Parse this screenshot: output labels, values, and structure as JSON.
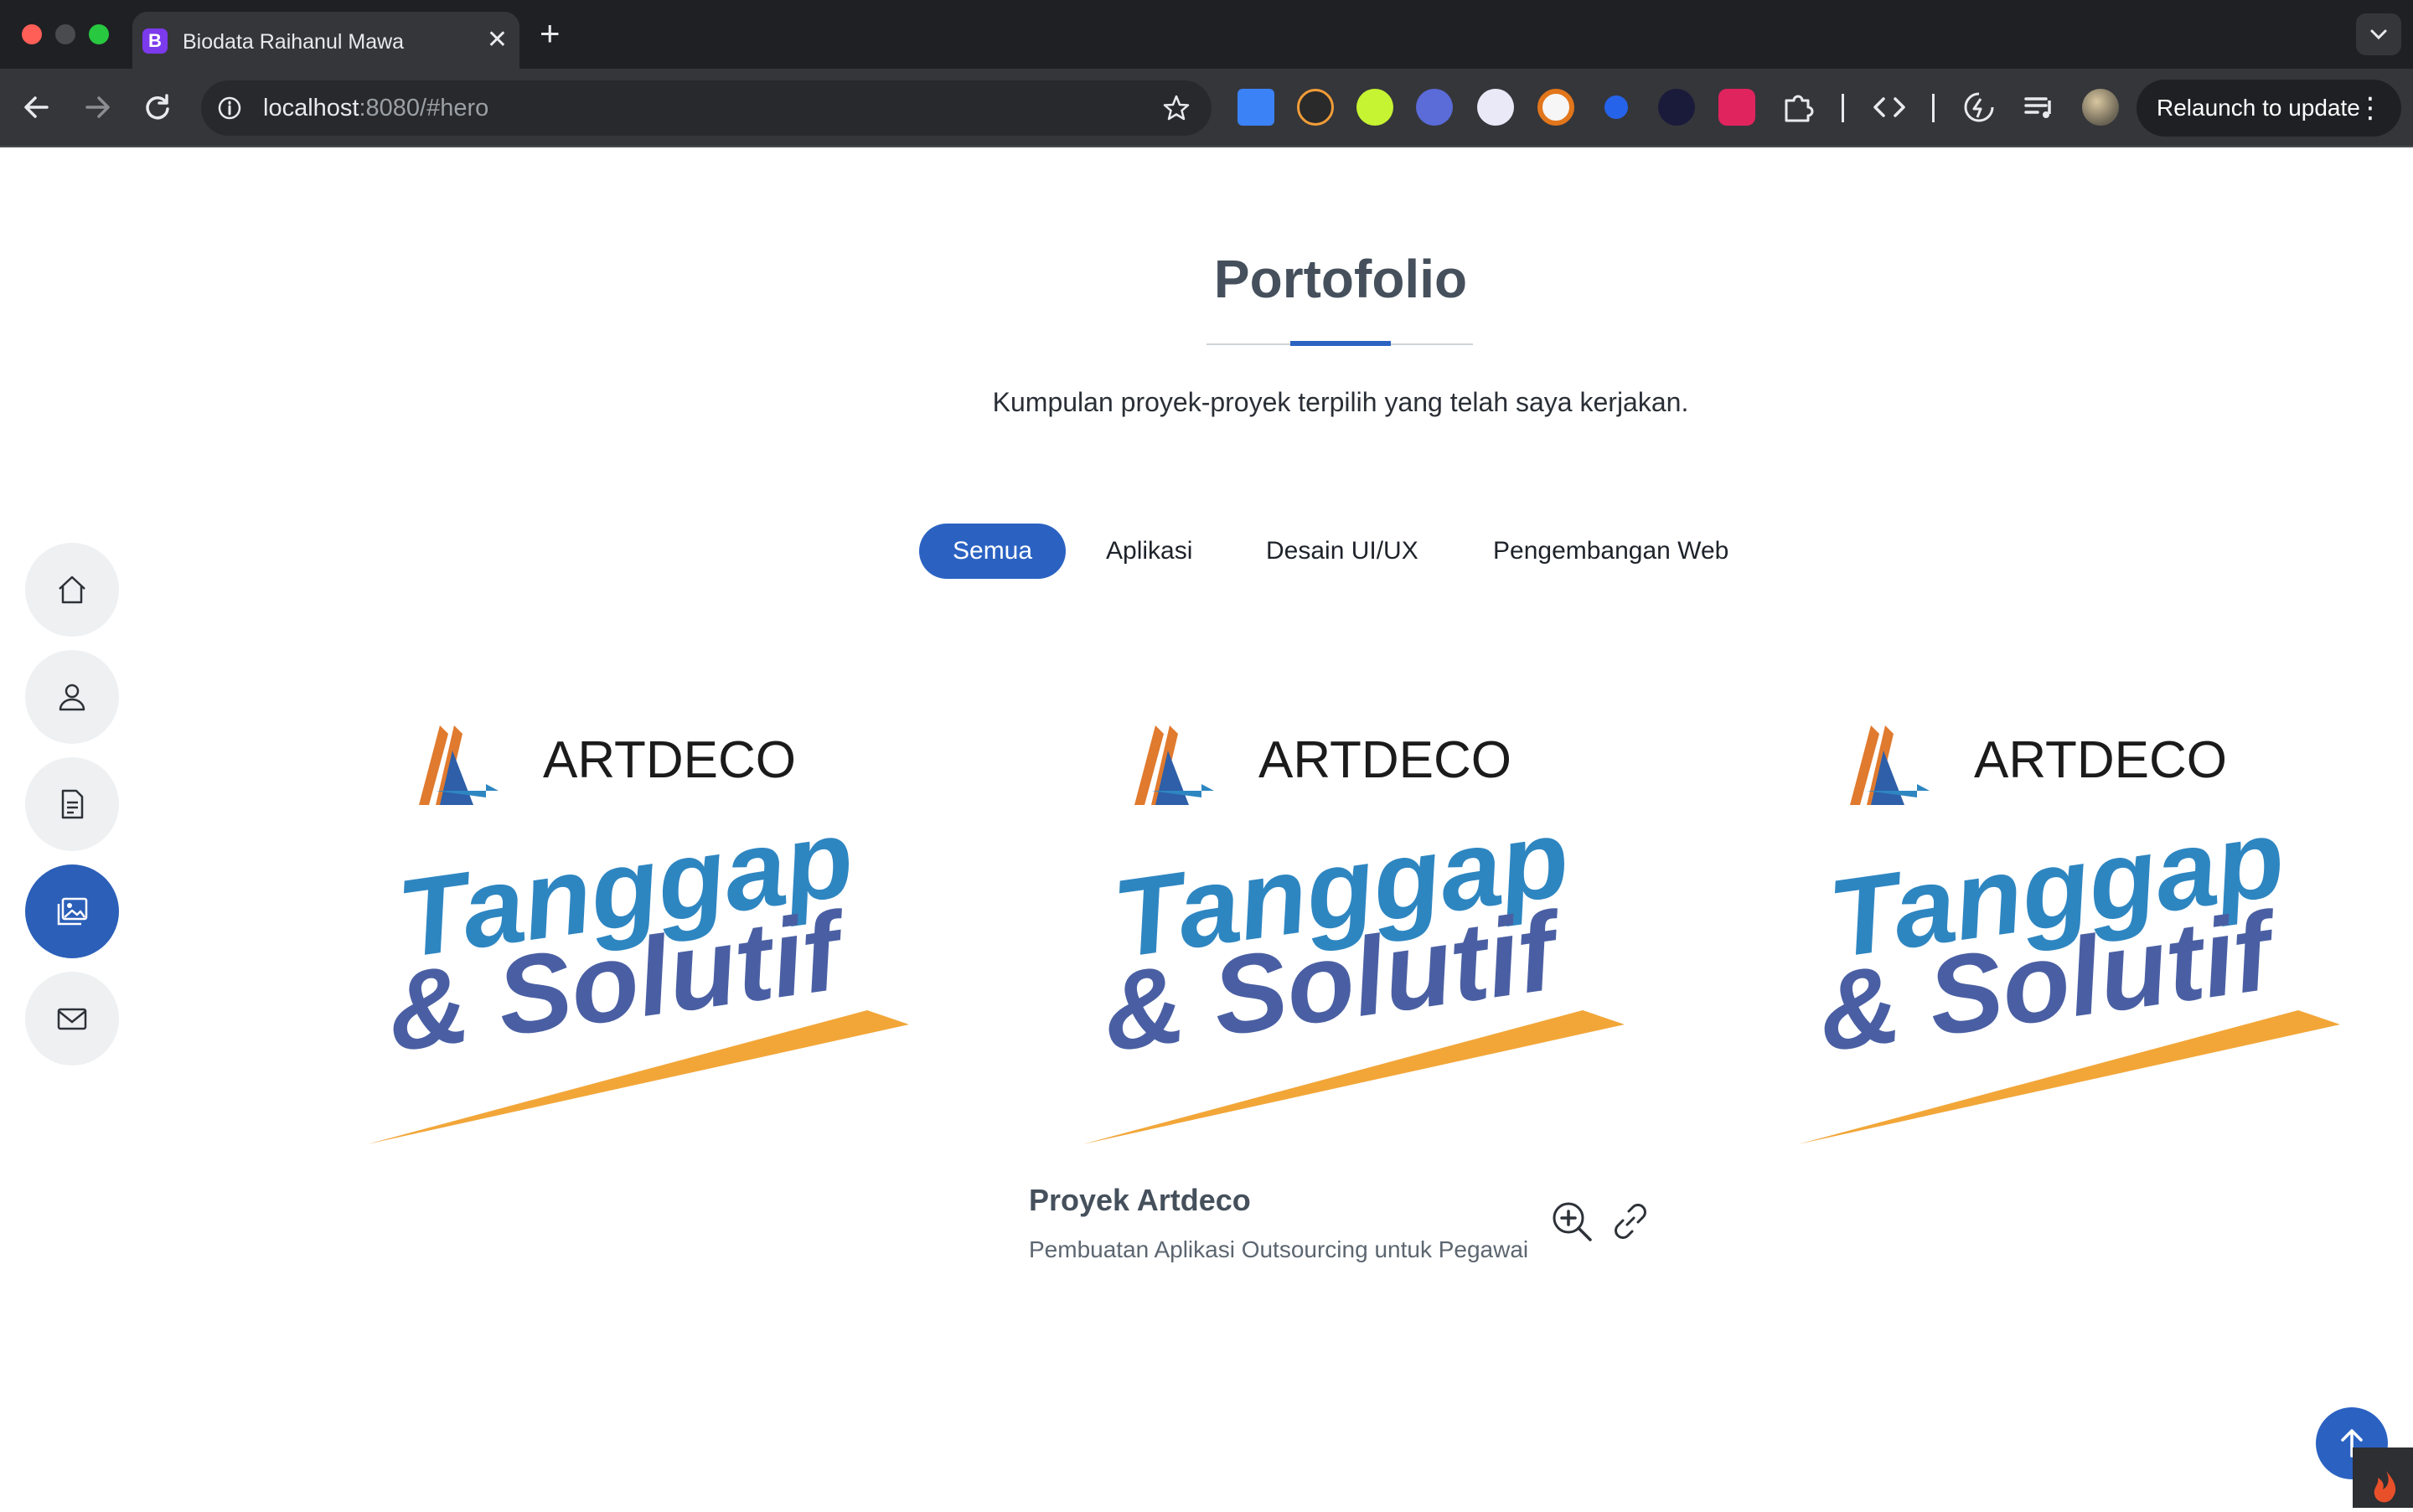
{
  "browser": {
    "tab_title": "Biodata Raihanul Mawa",
    "tab_favicon_letter": "B",
    "url_host": "localhost",
    "url_rest": ":8080/#hero",
    "relaunch_label": "Relaunch to update",
    "extensions": [
      "extension-1-icon",
      "extension-2-icon",
      "extension-3-icon",
      "extension-4-icon",
      "extension-5-icon",
      "metamask-icon",
      "extension-7-icon",
      "extension-8-icon",
      "shield-u-icon",
      "puzzle-icon",
      "code-icon",
      "extension-12-icon",
      "media-queue-icon",
      "profile-avatar-icon"
    ]
  },
  "page": {
    "section_title": "Portofolio",
    "subtitle": "Kumpulan proyek-proyek terpilih yang telah saya kerjakan.",
    "filters": [
      "Semua",
      "Aplikasi",
      "Desain UI/UX",
      "Pengembangan Web"
    ],
    "active_filter": "Semua",
    "sidenav": [
      "home-icon",
      "person-icon",
      "document-icon",
      "gallery-icon",
      "envelope-icon"
    ],
    "sidenav_active": "gallery-icon",
    "cards": [
      {
        "brand": "ARTDECO",
        "slogan_line1": "Tanggap",
        "slogan_line2": "& Solutif"
      },
      {
        "brand": "ARTDECO",
        "slogan_line1": "Tanggap",
        "slogan_line2": "& Solutif"
      },
      {
        "brand": "ARTDECO",
        "slogan_line1": "Tanggap",
        "slogan_line2": "& Solutif"
      }
    ],
    "featured": {
      "title": "Proyek Artdeco",
      "description": "Pembuatan Aplikasi Outsourcing untuk Pegawai"
    }
  },
  "colors": {
    "accent": "#2b62c2",
    "slogan_blue": "#2e86c1",
    "slogan_navy": "#4a5fa3",
    "slogan_orange": "#f2a638",
    "logo_orange": "#e07a2e"
  }
}
